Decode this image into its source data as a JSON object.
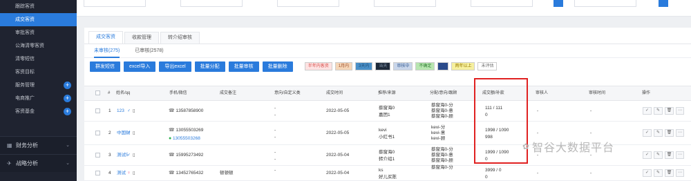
{
  "sidebar": {
    "items": [
      {
        "label": "跟踪客资",
        "active": false
      },
      {
        "label": "成交客资",
        "active": true
      },
      {
        "label": "审批客资",
        "active": false
      },
      {
        "label": "公海清零客资",
        "active": false
      },
      {
        "label": "清零短信",
        "active": false
      },
      {
        "label": "客资目标",
        "active": false
      },
      {
        "label": "服务管理",
        "active": false,
        "plus": true
      },
      {
        "label": "电商推广",
        "active": false,
        "plus": true
      },
      {
        "label": "客资基金",
        "active": false,
        "plus": true
      }
    ],
    "groups": [
      {
        "label": "财务分析",
        "icon": "bank-icon"
      },
      {
        "label": "战略分析",
        "icon": "plane-icon"
      }
    ]
  },
  "tabs": [
    "成交客资",
    "收款管理",
    "转介绍审核"
  ],
  "subtabs": [
    "未审核(275)",
    "已审核(2578)"
  ],
  "toolbar": {
    "buttons": [
      "群发短信",
      "excel导入",
      "导出excel",
      "批量分配",
      "批量审核",
      "批量删除"
    ],
    "tags": [
      {
        "label": "半年内客资",
        "bg": "#fde2e2",
        "fg": "#d9534f"
      },
      {
        "label": "1月内",
        "bg": "#f5d6b8",
        "fg": "#a0522d"
      },
      {
        "label": "3天内",
        "bg": "#4a90c8",
        "fg": "#1f4f7a"
      },
      {
        "label": "当天",
        "bg": "#1e2a3a",
        "fg": "#7d8fa5"
      },
      {
        "label": "审核中",
        "bg": "#c9d6ea",
        "fg": "#3a5f95"
      },
      {
        "label": "不确定",
        "bg": "#b8e6b0",
        "fg": "#2e7d32"
      },
      {
        "label": "无",
        "bg": "#2a4a8a",
        "fg": "#2a4a8a"
      },
      {
        "label": "两年以上",
        "bg": "#f6f0a0",
        "fg": "#9a7b00"
      },
      {
        "label": "未评估",
        "bg": "#ffffff",
        "fg": "#666666"
      }
    ]
  },
  "table": {
    "headers": [
      "#",
      "姓名/qq",
      "手机/微信",
      "成交备注",
      "意向/自定义类",
      "成交时间",
      "推荐/来源",
      "分配/意向/跟顾",
      "成交额/补款",
      "审核人",
      "审核时间",
      "操作"
    ],
    "rows": [
      {
        "index": "1",
        "name": "123",
        "gender": "male",
        "phone": "13587858900",
        "wechat": "",
        "note": "",
        "intent": [
          "-",
          "-"
        ],
        "date": "2022-05-05",
        "source": [
          "蔡窗海0",
          "嘉团1"
        ],
        "assign": [
          "蔡窗海0-分",
          "蔡窗海0-意",
          "蔡窗海0-顾"
        ],
        "amount": [
          "111 / 111",
          "0"
        ],
        "auditor": "-",
        "audit_time": "-"
      },
      {
        "index": "2",
        "name": "中国财",
        "gender": "male",
        "phone": "13055503269",
        "wechat": "13055503268",
        "note": "",
        "intent": [
          "-",
          "-"
        ],
        "date": "2022-05-05",
        "source": [
          "kevi",
          "小红书1"
        ],
        "assign": [
          "kevi-分",
          "kevi-意",
          "kevi-顾"
        ],
        "amount": [
          "1998 / 1090",
          "998"
        ],
        "auditor": "-",
        "audit_time": "-"
      },
      {
        "index": "3",
        "name": "测试5",
        "gender": "male",
        "phone": "15995273492",
        "wechat": "",
        "note": "",
        "intent": [
          "-",
          "-"
        ],
        "date": "2022-05-04",
        "source": [
          "蔡窗海0",
          "转介绍1"
        ],
        "assign": [
          "蔡窗海0-分",
          "蔡窗海0-意",
          "蔡窗海0-顾"
        ],
        "amount": [
          "1999 / 1090",
          "0"
        ],
        "auditor": "-",
        "audit_time": "-"
      },
      {
        "index": "4",
        "name": "测试",
        "gender": "female",
        "phone": "13452765432",
        "wechat": "",
        "note": "顿顿顿",
        "intent": [
          "-",
          ""
        ],
        "date": "2022-05-04",
        "source": [
          "ks",
          "好儿买陈"
        ],
        "assign": [
          "蔡窗海0-分",
          ""
        ],
        "amount": [
          "3999 / 0",
          "0"
        ],
        "auditor": "-",
        "audit_time": "-"
      }
    ]
  },
  "watermark": "智谷大数据平台",
  "colors": {
    "accent": "#2a7bdc",
    "sidebar": "#1f2330",
    "highlight": "#e02020"
  }
}
